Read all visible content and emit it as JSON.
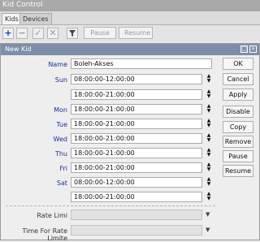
{
  "window": {
    "title": "Kid Control"
  },
  "tabs": [
    "Kids",
    "Devices"
  ],
  "toolbar": {
    "icons": [
      "plus-icon",
      "minus-icon",
      "check-icon",
      "cross-icon",
      "filter-icon"
    ],
    "pause_label": "Pause",
    "resume_label": "Resume"
  },
  "dialog": {
    "title": "New Kid",
    "name_label": "Name",
    "name_value": "Boleh-Akses",
    "days": [
      {
        "label": "Sun",
        "value": "08:00:00-12:00:00"
      },
      {
        "label": "",
        "value": "18:00:00-21:00:00"
      },
      {
        "label": "Mon",
        "value": "18:00:00-21:00:00"
      },
      {
        "label": "Tue",
        "value": "18:00:00-21:00:00"
      },
      {
        "label": "Wed",
        "value": "18:00:00-21:00:00"
      },
      {
        "label": "Thu",
        "value": "18:00:00-21:00:00"
      },
      {
        "label": "Fri",
        "value": "18:00:00-21:00:00"
      },
      {
        "label": "Sat",
        "value": "08:00:00-12:00:00"
      },
      {
        "label": "",
        "value": "18:00:00-21:00:00"
      }
    ],
    "rate_limit_label": "Rate Limi",
    "rate_limit_value": "",
    "time_for_rate_limit_label": "Time For Rate Limite",
    "time_for_rate_limit_value": "",
    "buttons": [
      "OK",
      "Cancel",
      "Apply",
      "Disable",
      "Copy",
      "Remove",
      "Pause",
      "Resume"
    ]
  },
  "colors": {
    "day_label": "#1a2fa0",
    "dialog_title_bg": "#7d8fa8",
    "plus_icon": "#1a3fb0"
  }
}
